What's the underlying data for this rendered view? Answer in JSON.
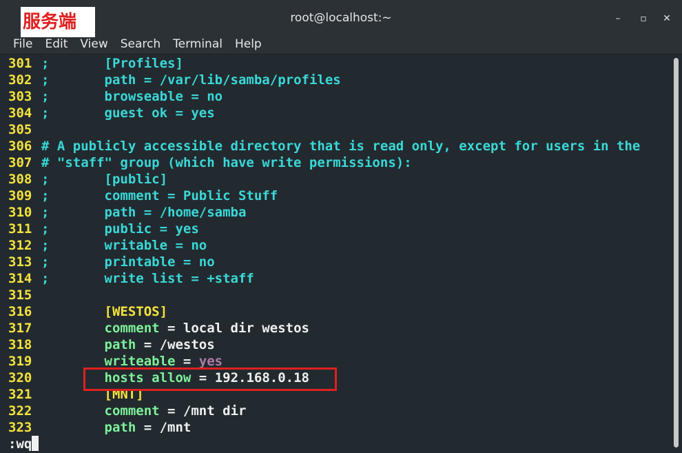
{
  "window": {
    "title": "root@localhost:~",
    "controls": {
      "minimize": "–",
      "maximize": "▫",
      "close": "✕"
    }
  },
  "overlay_label": "服务端",
  "menu": [
    "File",
    "Edit",
    "View",
    "Search",
    "Terminal",
    "Help"
  ],
  "lines": [
    {
      "n": "301",
      "a": ";",
      "b": "[Profiles]",
      "style": "cyan"
    },
    {
      "n": "302",
      "a": ";",
      "b": "path = /var/lib/samba/profiles",
      "style": "cyan"
    },
    {
      "n": "303",
      "a": ";",
      "b": "browseable = no",
      "style": "cyan"
    },
    {
      "n": "304",
      "a": ";",
      "b": "guest ok = yes",
      "style": "cyan"
    },
    {
      "n": "305",
      "a": "",
      "b": "",
      "style": "cyan"
    },
    {
      "n": "306",
      "a": "# A publicly accessible directory that is read only, except for users in the",
      "b": "",
      "style": "cyan"
    },
    {
      "n": "307",
      "a": "# \"staff\" group (which have write permissions):",
      "b": "",
      "style": "cyan"
    },
    {
      "n": "308",
      "a": ";",
      "b": "[public]",
      "style": "cyan"
    },
    {
      "n": "309",
      "a": ";",
      "b": "comment = Public Stuff",
      "style": "cyan"
    },
    {
      "n": "310",
      "a": ";",
      "b": "path = /home/samba",
      "style": "cyan"
    },
    {
      "n": "311",
      "a": ";",
      "b": "public = yes",
      "style": "cyan"
    },
    {
      "n": "312",
      "a": ";",
      "b": "writable = no",
      "style": "cyan"
    },
    {
      "n": "313",
      "a": ";",
      "b": "printable = no",
      "style": "cyan"
    },
    {
      "n": "314",
      "a": ";",
      "b": "write list = +staff",
      "style": "cyan"
    },
    {
      "n": "315",
      "a": "",
      "b": "",
      "style": "cyan"
    },
    {
      "n": "316",
      "key": "[WESTOS]",
      "val": "",
      "style": "section"
    },
    {
      "n": "317",
      "key": "comment",
      "val": "local dir westos",
      "style": "kv"
    },
    {
      "n": "318",
      "key": "path",
      "val": "/westos",
      "style": "kv"
    },
    {
      "n": "319",
      "key": "writeable",
      "val": "yes",
      "style": "kv-pink"
    },
    {
      "n": "320",
      "key": "hosts allow",
      "val": "192.168.0.18",
      "style": "kv"
    },
    {
      "n": "321",
      "key": "[MNT]",
      "val": "",
      "style": "section"
    },
    {
      "n": "322",
      "key": "comment",
      "val": "/mnt dir",
      "style": "kv"
    },
    {
      "n": "323",
      "key": "path",
      "val": "/mnt",
      "style": "kv"
    }
  ],
  "command_line": ":wq"
}
